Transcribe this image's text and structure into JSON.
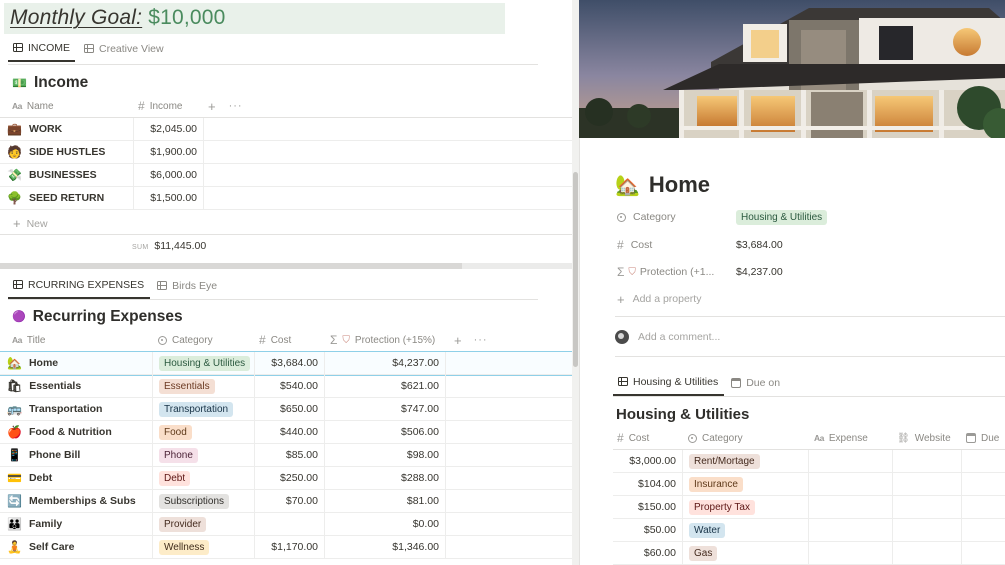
{
  "goal": {
    "label": "Monthly Goal:",
    "amount": "$10,000"
  },
  "income_tabs": [
    {
      "label": "INCOME"
    },
    {
      "label": "Creative View"
    }
  ],
  "income": {
    "title": "Income",
    "columns": [
      "Name",
      "Income"
    ],
    "rows": [
      {
        "name": "WORK",
        "value": "$2,045.00",
        "icon": "briefcase-icon"
      },
      {
        "name": "SIDE HUSTLES",
        "value": "$1,900.00",
        "icon": "person-icon"
      },
      {
        "name": "BUSINESSES",
        "value": "$6,000.00",
        "icon": "money-icon"
      },
      {
        "name": "SEED RETURN",
        "value": "$1,500.00",
        "icon": "tree-icon"
      }
    ],
    "new_label": "New",
    "sum_label": "SUM",
    "sum_value": "$11,445.00"
  },
  "expense_tabs": [
    {
      "label": "RCURRING EXPENSES"
    },
    {
      "label": "Birds Eye"
    }
  ],
  "expenses": {
    "title": "Recurring Expenses",
    "columns": [
      "Title",
      "Category",
      "Cost",
      "Protection (+15%)"
    ],
    "rows": [
      {
        "title": "Home",
        "category": "Housing & Utilities",
        "cost": "$3,684.00",
        "protection": "$4,237.00",
        "tag_bg": "#dbeddb",
        "tag_fg": "#2b593f"
      },
      {
        "title": "Essentials",
        "category": "Essentials",
        "cost": "$540.00",
        "protection": "$621.00",
        "tag_bg": "#f4dfd4",
        "tag_fg": "#6b3a22"
      },
      {
        "title": "Transportation",
        "category": "Transportation",
        "cost": "$650.00",
        "protection": "$747.00",
        "tag_bg": "#d3e5ef",
        "tag_fg": "#183347"
      },
      {
        "title": "Food & Nutrition",
        "category": "Food",
        "cost": "$440.00",
        "protection": "$506.00",
        "tag_bg": "#fadec9",
        "tag_fg": "#5f3a1a"
      },
      {
        "title": "Phone Bill",
        "category": "Phone",
        "cost": "$85.00",
        "protection": "$98.00",
        "tag_bg": "#f5e0e9",
        "tag_fg": "#4c2337"
      },
      {
        "title": "Debt",
        "category": "Debt",
        "cost": "$250.00",
        "protection": "$288.00",
        "tag_bg": "#ffe2dd",
        "tag_fg": "#5d1715"
      },
      {
        "title": "Memberships & Subs",
        "category": "Subscriptions",
        "cost": "$70.00",
        "protection": "$81.00",
        "tag_bg": "#e3e2e0",
        "tag_fg": "#32302c"
      },
      {
        "title": "Family",
        "category": "Provider",
        "cost": "",
        "protection": "$0.00",
        "tag_bg": "#eee0da",
        "tag_fg": "#442a1e"
      },
      {
        "title": "Self Care",
        "category": "Wellness",
        "cost": "$1,170.00",
        "protection": "$1,346.00",
        "tag_bg": "#fdecc8",
        "tag_fg": "#402c1b"
      }
    ]
  },
  "detail": {
    "title": "Home",
    "properties": [
      {
        "name": "Category",
        "value": "Housing & Utilities",
        "type": "tag"
      },
      {
        "name": "Cost",
        "value": "$3,684.00",
        "type": "number"
      },
      {
        "name": "Protection (+1...",
        "value": "$4,237.00",
        "type": "formula"
      }
    ],
    "add_property": "Add a property",
    "comment_placeholder": "Add a comment..."
  },
  "detail_tabs": [
    {
      "label": "Housing & Utilities"
    },
    {
      "label": "Due on"
    }
  ],
  "utilities": {
    "title": "Housing & Utilities",
    "columns": [
      "Cost",
      "Category",
      "Expense",
      "Website",
      "Due"
    ],
    "rows": [
      {
        "cost": "$3,000.00",
        "category": "Rent/Mortage",
        "tag_bg": "#eee0da",
        "tag_fg": "#442a1e"
      },
      {
        "cost": "$104.00",
        "category": "Insurance",
        "tag_bg": "#fadec9",
        "tag_fg": "#5f3a1a"
      },
      {
        "cost": "$150.00",
        "category": "Property Tax",
        "tag_bg": "#ffe2dd",
        "tag_fg": "#5d1715"
      },
      {
        "cost": "$50.00",
        "category": "Water",
        "tag_bg": "#d3e5ef",
        "tag_fg": "#183347"
      },
      {
        "cost": "$60.00",
        "category": "Gas",
        "tag_bg": "#eee0da",
        "tag_fg": "#442a1e"
      }
    ]
  }
}
